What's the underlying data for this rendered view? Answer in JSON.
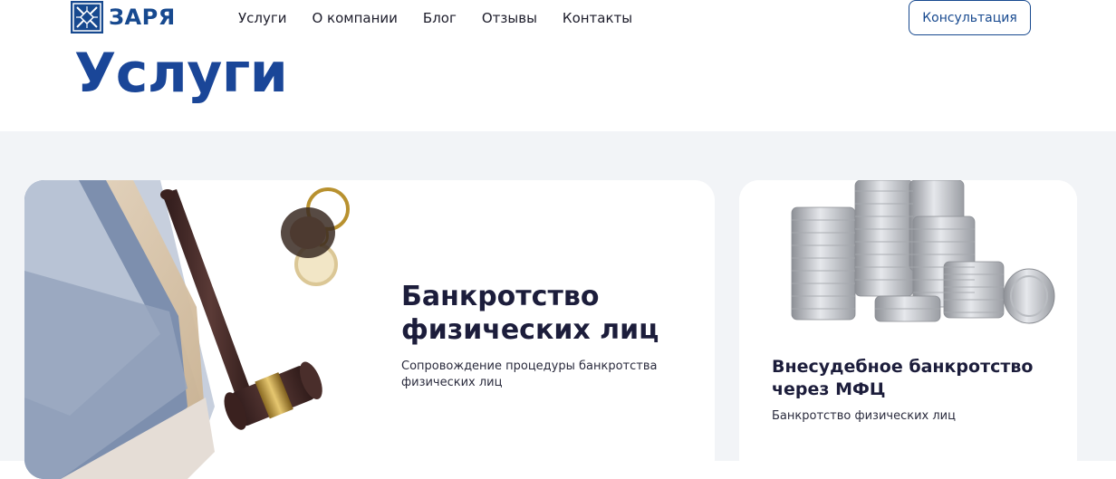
{
  "brand": {
    "name": "ЗАРЯ",
    "color": "#17498f"
  },
  "nav": {
    "items": [
      "Услуги",
      "О компании",
      "Блог",
      "Отзывы",
      "Контакты"
    ]
  },
  "header": {
    "cta_label": "Консультация"
  },
  "page": {
    "title": "Услуги"
  },
  "cards": [
    {
      "title": "Банкротство физических лиц",
      "description": "Сопровождение процедуры банкротства физических лиц",
      "illustration": "gavel-documents-glasses"
    },
    {
      "title": "Внесудебное банкротство через МФЦ",
      "description": "Банкротство физических лиц",
      "illustration": "coin-stacks"
    }
  ]
}
